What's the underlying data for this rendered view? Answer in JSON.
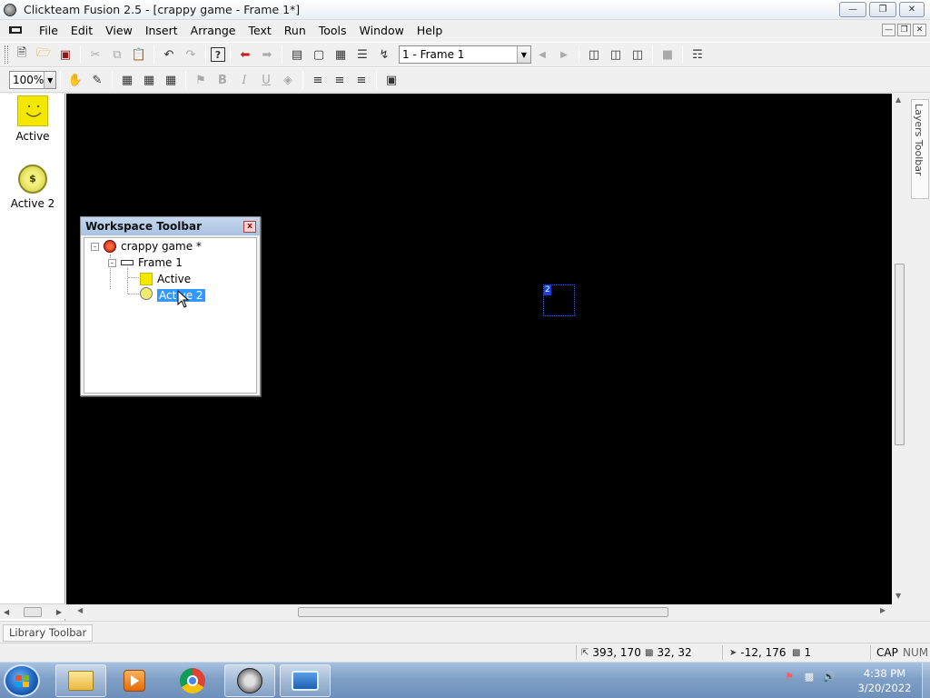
{
  "window": {
    "title": "Clickteam Fusion 2.5 - [crappy game - Frame 1*]",
    "controls": [
      "minimize",
      "maximize",
      "close"
    ]
  },
  "menu": {
    "items": [
      "File",
      "Edit",
      "View",
      "Insert",
      "Arrange",
      "Text",
      "Run",
      "Tools",
      "Window",
      "Help"
    ]
  },
  "toolbar1": {
    "frame_selector_value": "1 - Frame 1"
  },
  "toolbar2": {
    "zoom_value": "100%",
    "bold": "B",
    "italic": "I",
    "underline": "U"
  },
  "objects_panel": {
    "items": [
      {
        "label": "Active",
        "icon": "smiley-icon"
      },
      {
        "label": "Active 2",
        "icon": "coin-icon",
        "glyph": "$"
      }
    ]
  },
  "editor": {
    "selected_object_label": "2"
  },
  "layers_toolbar": {
    "label": "Layers Toolbar"
  },
  "workspace": {
    "title": "Workspace Toolbar",
    "close": "x",
    "tree": {
      "app": "crappy game *",
      "frame": "Frame 1",
      "objects": [
        "Active",
        "Active 2"
      ]
    }
  },
  "library_toolbar": {
    "label": "Library Toolbar"
  },
  "statusbar": {
    "position": "393, 170",
    "size": "32, 32",
    "mouse": "-12, 176",
    "layer": "1",
    "caps": "CAP",
    "num": "NUM"
  },
  "taskbar": {
    "time": "4:38 PM",
    "date": "3/20/2022",
    "apps": [
      "file-explorer",
      "media-player",
      "chrome",
      "clickteam-fusion",
      "window-app"
    ]
  },
  "colors": {
    "editor_background": "#000000",
    "selection": "#3399ff",
    "object_yellow": "#f5e800",
    "taskbar": "#7f9fc6"
  }
}
